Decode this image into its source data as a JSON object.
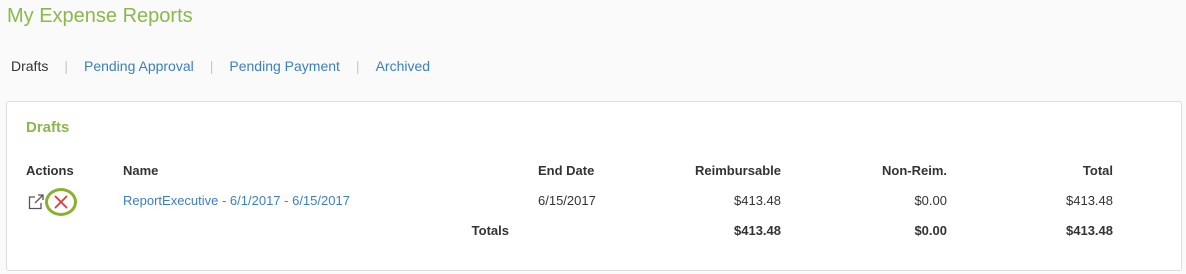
{
  "page": {
    "title": "My Expense Reports"
  },
  "tabs": [
    {
      "label": "Drafts",
      "active": true
    },
    {
      "label": "Pending Approval",
      "active": false
    },
    {
      "label": "Pending Payment",
      "active": false
    },
    {
      "label": "Archived",
      "active": false
    }
  ],
  "colors": {
    "accent": "#8ab84a",
    "link": "#3a7fc4",
    "delete": "#e0393e",
    "highlight_ring": "#8ab02e"
  },
  "drafts": {
    "title": "Drafts",
    "columns": {
      "actions": "Actions",
      "name": "Name",
      "end_date": "End Date",
      "reimbursable": "Reimbursable",
      "non_reim": "Non-Reim.",
      "total": "Total"
    },
    "rows": [
      {
        "actions": [
          "edit-icon",
          "delete-icon"
        ],
        "name": "ReportExecutive - 6/1/2017 - 6/15/2017",
        "end_date": "6/15/2017",
        "reimbursable": "$413.48",
        "non_reim": "$0.00",
        "total": "$413.48"
      }
    ],
    "totals": {
      "label": "Totals",
      "reimbursable": "$413.48",
      "non_reim": "$0.00",
      "total": "$413.48"
    }
  }
}
